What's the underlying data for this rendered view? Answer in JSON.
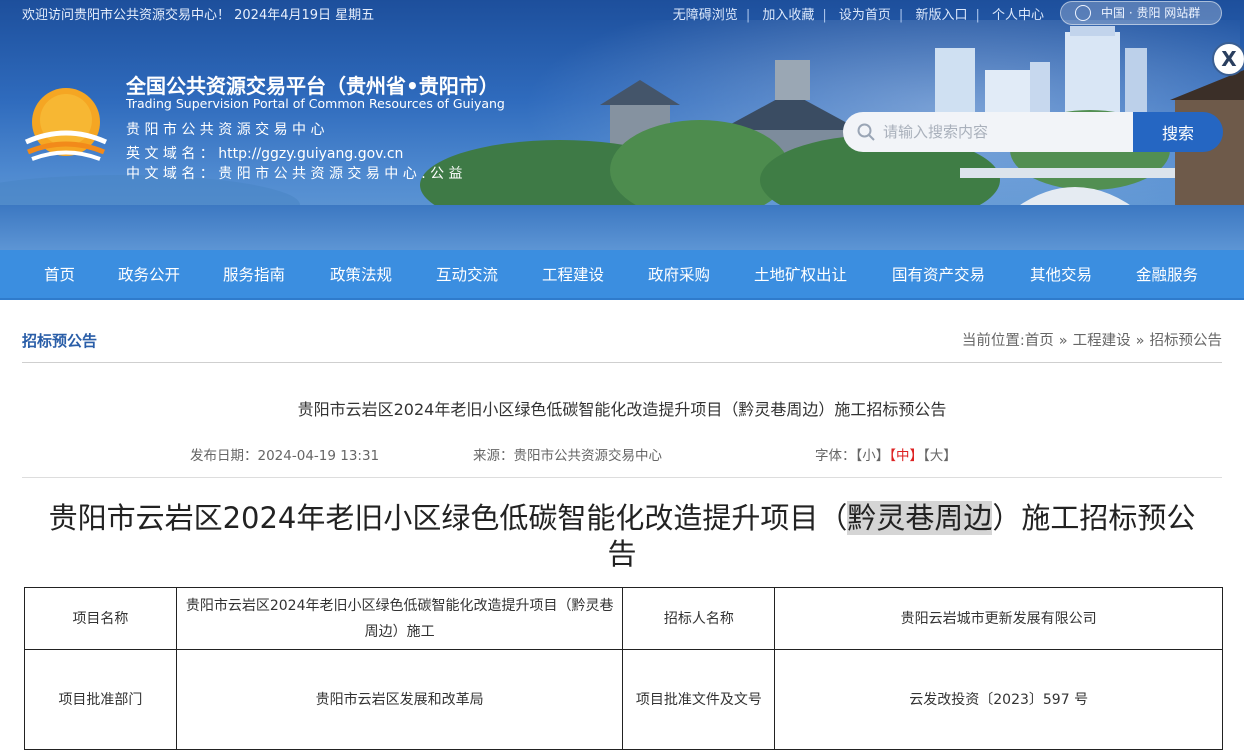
{
  "topbar": {
    "welcome": "欢迎访问贵阳市公共资源交易中心！ 2024年4月19日 星期五",
    "links": [
      "无障碍浏览",
      "加入收藏",
      "设为首页",
      "新版入口",
      "个人中心"
    ],
    "site_group": "中国 · 贵阳   网站群",
    "close": "X"
  },
  "header": {
    "title_cn": "全国公共资源交易平台（贵州省•贵阳市）",
    "title_en": "Trading Supervision Portal of Common Resources of Guiyang",
    "center_name": "贵 阳 市 公 共 资 源 交 易 中 心",
    "en_domain": "英 文 域 名 ： http://ggzy.guiyang.gov.cn",
    "cn_domain": "中 文 域 名 ： 贵 阳 市 公 共 资 源 交 易 中 心 . 公 益"
  },
  "search": {
    "placeholder": "请输入搜索内容",
    "button": "搜索"
  },
  "nav": [
    "首页",
    "政务公开",
    "服务指南",
    "政策法规",
    "互动交流",
    "工程建设",
    "政府采购",
    "土地矿权出让",
    "国有资产交易",
    "其他交易",
    "金融服务"
  ],
  "section": {
    "title": "招标预公告",
    "breadcrumb_prefix": "当前位置:",
    "breadcrumb": [
      "首页",
      "工程建设",
      "招标预公告"
    ]
  },
  "article": {
    "title": "贵阳市云岩区2024年老旧小区绿色低碳智能化改造提升项目（黔灵巷周边）施工招标预公告",
    "publish": "发布日期：2024-04-19 13:31",
    "source": "来源：贵阳市公共资源交易中心",
    "font_label": "字体：",
    "font_sizes": [
      "【小】",
      "【中】",
      "【大】"
    ],
    "big_title_before": "贵阳市云岩区2024年老旧小区绿色低碳智能化改造提升项目（",
    "big_title_highlight": "黔灵巷周边",
    "big_title_after": "）施工招标预公告"
  },
  "table": {
    "r1c1": "项目名称",
    "r1c2": "贵阳市云岩区2024年老旧小区绿色低碳智能化改造提升项目（黔灵巷周边）施工",
    "r1c3": "招标人名称",
    "r1c4": "贵阳云岩城市更新发展有限公司",
    "r2c1": "项目批准部门",
    "r2c2": "贵阳市云岩区发展和改革局",
    "r2c3": "项目批准文件及文号",
    "r2c4": "云发改投资〔2023〕597 号"
  }
}
